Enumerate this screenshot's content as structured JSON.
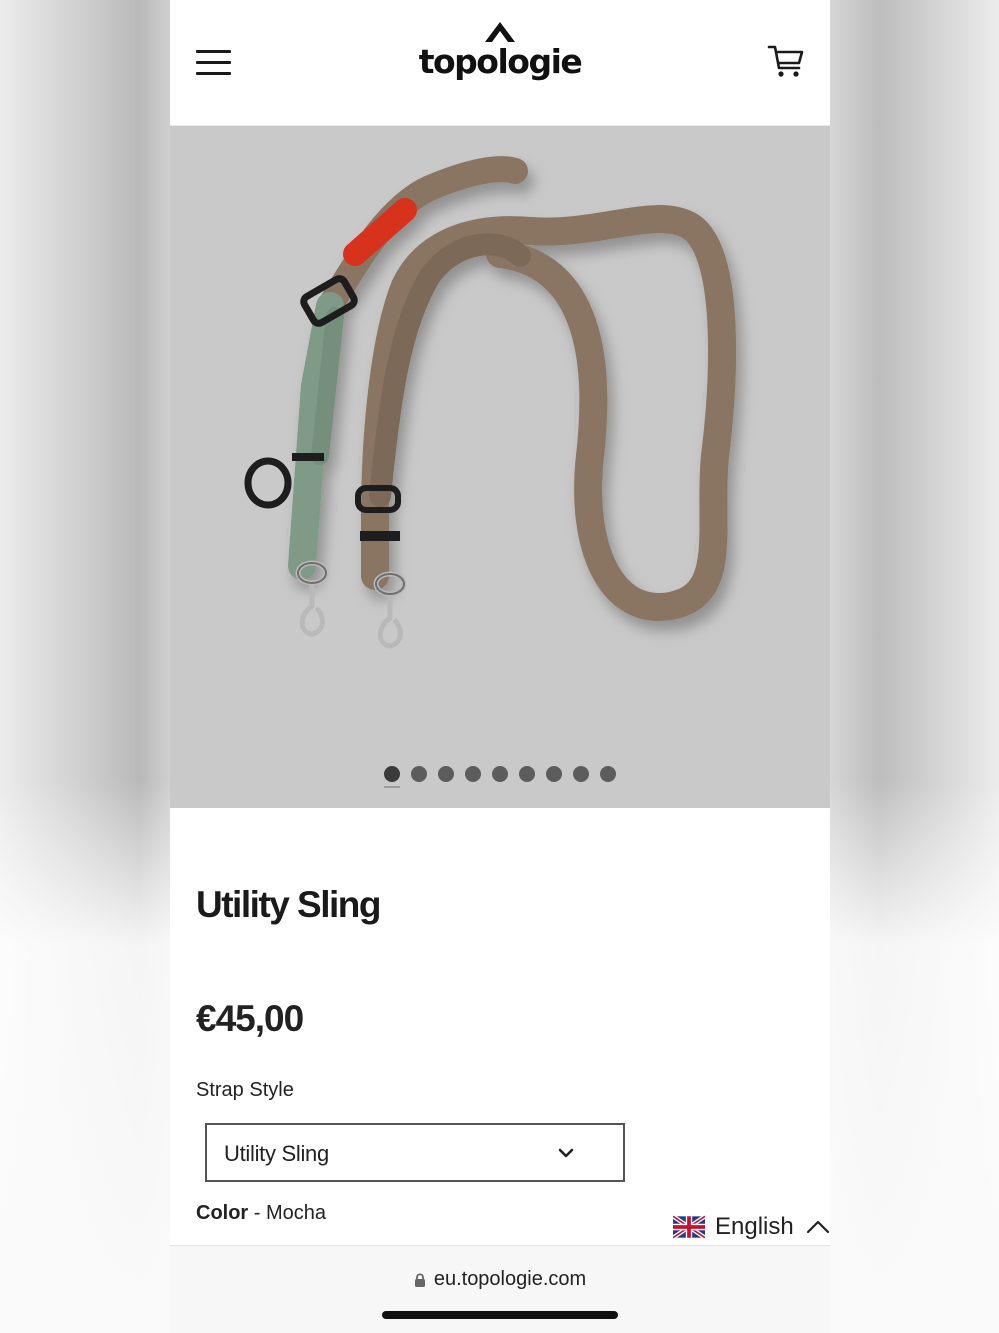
{
  "header": {
    "brand": "topologie",
    "menu_icon": "hamburger-menu-icon",
    "cart_icon": "shopping-cart-icon"
  },
  "gallery": {
    "total_images": 9,
    "active_index": 0
  },
  "product": {
    "title": "Utility Sling",
    "price": "€45,00",
    "strap_style_label": "Strap Style",
    "strap_style_value": "Utility Sling",
    "color_label": "Color",
    "color_separator": " - ",
    "color_value": "Mocha"
  },
  "language": {
    "label": "English",
    "flag_icon": "uk-flag-icon"
  },
  "browser": {
    "url": "eu.topologie.com"
  },
  "colors": {
    "strap_mocha": "#8a7562",
    "strap_sage": "#7f9a86",
    "accent_red": "#d6321f",
    "image_bg": "#c9c9c9"
  }
}
